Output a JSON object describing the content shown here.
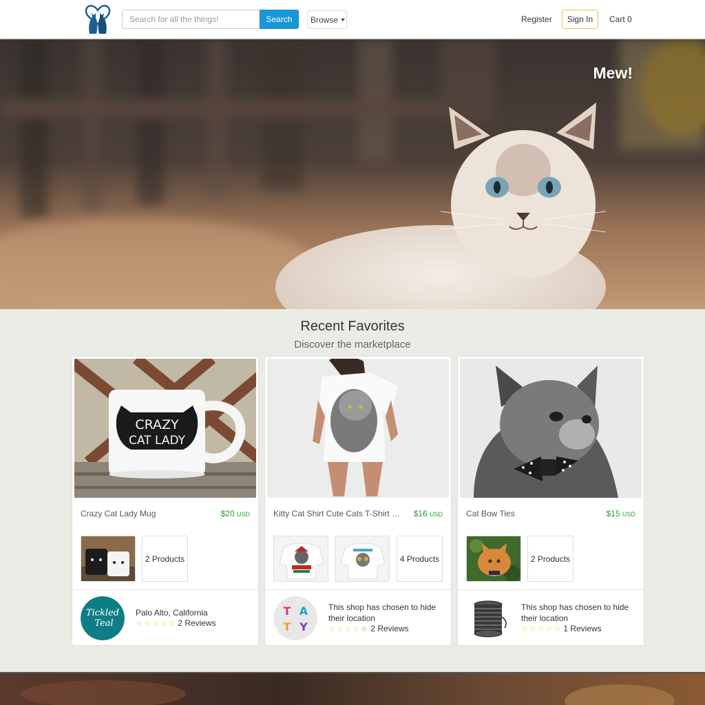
{
  "nav": {
    "search_placeholder": "Search for all the things!",
    "search_button": "Search",
    "browse": "Browse",
    "register": "Register",
    "sign_in": "Sign In",
    "cart": "Cart 0"
  },
  "hero": {
    "title": "Mew!"
  },
  "section": {
    "title": "Recent Favorites",
    "subtitle": "Discover the marketplace"
  },
  "cards": [
    {
      "name": "Crazy Cat Lady Mug",
      "price": "$20",
      "currency": "USD",
      "image_text": [
        "CRAZY",
        "CAT LADY"
      ],
      "products": "2 Products",
      "shop_location": "Palo Alto, California",
      "reviews": "2 Reviews",
      "avatar_text": [
        "Tickled",
        "Teal"
      ]
    },
    {
      "name": "Kitty Cat Shirt Cute Cats T-Shirt W...",
      "price": "$16",
      "currency": "USD",
      "products": "4 Products",
      "shop_location": "This shop has chosen to hide their location",
      "reviews": "2 Reviews",
      "avatar_text": [
        "T",
        "A",
        "T",
        "Y"
      ]
    },
    {
      "name": "Cat Bow Ties",
      "price": "$15",
      "currency": "USD",
      "products": "2 Products",
      "shop_location": "This shop has chosen to hide their location",
      "reviews": "1 Reviews"
    }
  ],
  "colors": {
    "accent": "#1a96d8",
    "price": "#2a9d2a",
    "star": "#f5c842",
    "signin_border": "#f0c14b"
  }
}
